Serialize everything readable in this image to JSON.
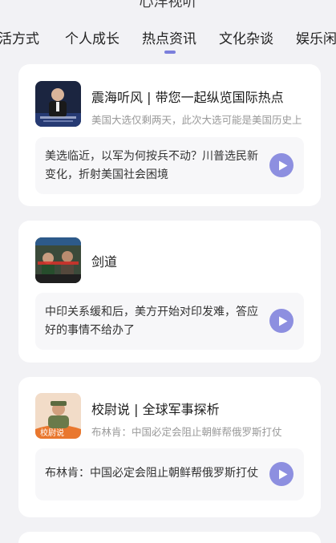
{
  "header": {
    "partial_title": "心洋视听"
  },
  "tabs": [
    {
      "label": "活方式"
    },
    {
      "label": "个人成长"
    },
    {
      "label": "热点资讯"
    },
    {
      "label": "文化杂谈"
    },
    {
      "label": "娱乐闲"
    }
  ],
  "active_tab_index": 2,
  "colors": {
    "accent": "#8d8fe0",
    "indicator": "#7b7fdc",
    "background": "#f2f2f5"
  },
  "cards": [
    {
      "title": "震海听风 | 带您一起纵览国际热点",
      "subtitle": "美国大选仅剩两天，此次大选可能是美国历史上",
      "item_text": "美选临近，以军为何按兵不动？川普选民新变化，折射美国社会困境",
      "play_icon": "play-icon"
    },
    {
      "title": "剑道",
      "subtitle": "",
      "item_text": "中印关系缓和后，美方开始对印发难，答应好的事情不给办了",
      "play_icon": "play-icon"
    },
    {
      "title": "校尉说 | 全球军事探析",
      "subtitle": "布林肯：中国必定会阻止朝鲜帮俄罗斯打仗",
      "avatar_caption": "校尉说",
      "item_text": "布林肯：中国必定会阻止朝鲜帮俄罗斯打仗",
      "play_icon": "play-icon"
    }
  ]
}
